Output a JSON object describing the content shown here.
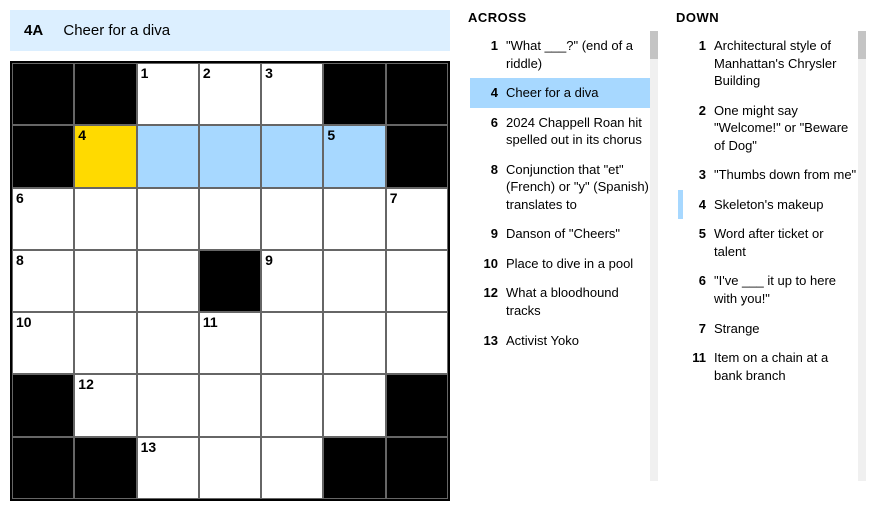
{
  "current": {
    "label": "4A",
    "text": "Cheer for a diva"
  },
  "grid": {
    "rows": 7,
    "cols": 7,
    "cells": [
      [
        "B",
        "B",
        "W1",
        "W2",
        "W3",
        "B",
        "B"
      ],
      [
        "B",
        "F4",
        "H",
        "H",
        "H",
        "H5",
        "B"
      ],
      [
        "W6",
        "W",
        "W",
        "W",
        "W",
        "W",
        "W7"
      ],
      [
        "W8",
        "W",
        "W",
        "B",
        "W9",
        "W",
        "W"
      ],
      [
        "W10",
        "W",
        "W",
        "W11",
        "W",
        "W",
        "W"
      ],
      [
        "B",
        "W12",
        "W",
        "W",
        "W",
        "W",
        "B"
      ],
      [
        "B",
        "B",
        "W13",
        "W",
        "W",
        "B",
        "B"
      ]
    ]
  },
  "across": [
    {
      "n": "1",
      "t": "\"What ___?\" (end of a riddle)"
    },
    {
      "n": "4",
      "t": "Cheer for a diva",
      "sel": true
    },
    {
      "n": "6",
      "t": "2024 Chappell Roan hit spelled out in its chorus"
    },
    {
      "n": "8",
      "t": "Conjunction that \"et\" (French) or \"y\" (Spanish) translates to"
    },
    {
      "n": "9",
      "t": "Danson of \"Cheers\""
    },
    {
      "n": "10",
      "t": "Place to dive in a pool"
    },
    {
      "n": "12",
      "t": "What a bloodhound tracks"
    },
    {
      "n": "13",
      "t": "Activist Yoko"
    }
  ],
  "down": [
    {
      "n": "1",
      "t": "Architectural style of Manhattan's Chrysler Building"
    },
    {
      "n": "2",
      "t": "One might say \"Welcome!\" or \"Beware of Dog\""
    },
    {
      "n": "3",
      "t": "\"Thumbs down from me\""
    },
    {
      "n": "4",
      "t": "Skeleton's makeup",
      "rel": true
    },
    {
      "n": "5",
      "t": "Word after ticket or talent"
    },
    {
      "n": "6",
      "t": "\"I've ___ it up to here with you!\""
    },
    {
      "n": "7",
      "t": "Strange"
    },
    {
      "n": "11",
      "t": "Item on a chain at a bank branch"
    }
  ],
  "headers": {
    "across": "ACROSS",
    "down": "DOWN"
  }
}
